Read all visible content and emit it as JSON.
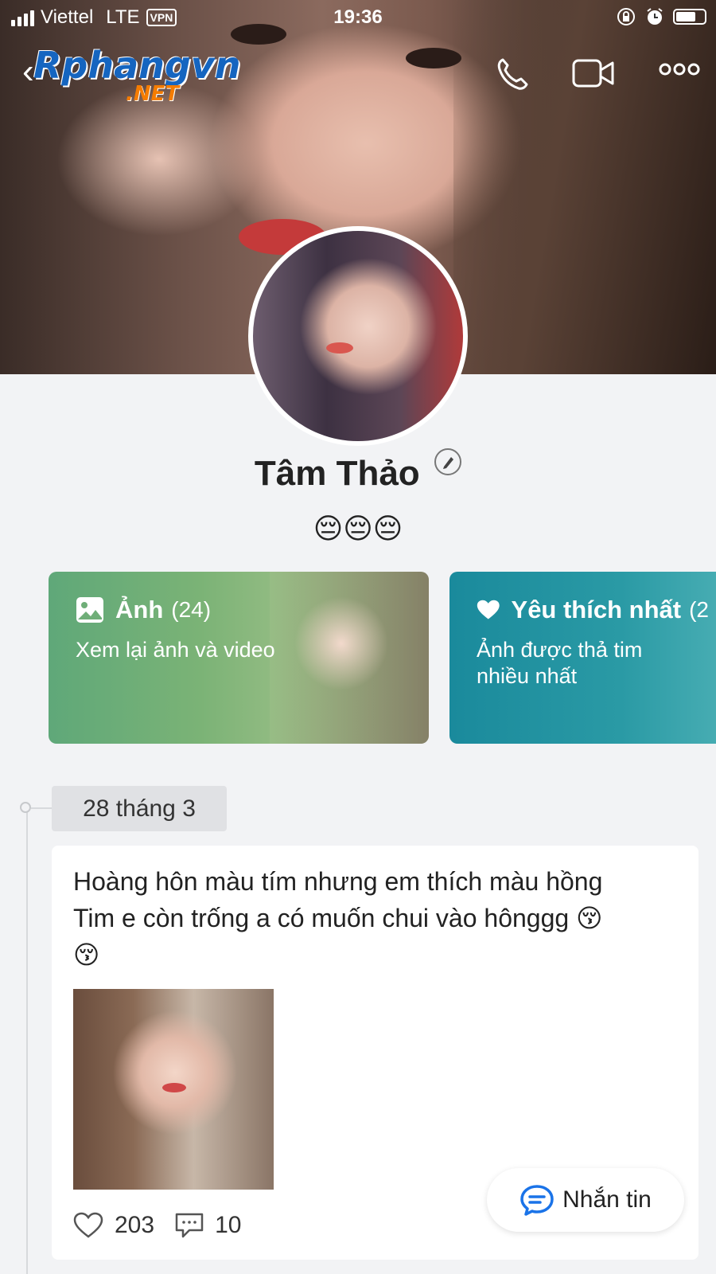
{
  "status_bar": {
    "carrier": "Viettel",
    "network": "LTE",
    "vpn": "VPN",
    "time": "19:36"
  },
  "watermark": {
    "main": "Rphangvn",
    "sub": ".NET"
  },
  "profile": {
    "name": "Tâm Thảo",
    "status": "😔😔😔"
  },
  "cards": {
    "photos": {
      "title": "Ảnh",
      "count": "(24)",
      "subtitle": "Xem lại ảnh và video"
    },
    "favorites": {
      "title": "Yêu thích nhất",
      "count": "(2",
      "subtitle": "Ảnh được thả tim nhiều nhất"
    }
  },
  "timeline": {
    "date": "28 tháng 3"
  },
  "post": {
    "text_line1": "Hoàng hôn màu tím nhưng em thích màu hồng",
    "text_line2": "Tim e còn trống a có muốn chui vào hônggg 😚",
    "text_line3": "😚",
    "likes": "203",
    "comments": "10"
  },
  "message_button": {
    "label": "Nhắn tin"
  },
  "colors": {
    "photos_card": "#6fae78",
    "favorites_card": "#1f90a0",
    "message_icon": "#1a73e8"
  },
  "icons": [
    "back-icon",
    "phone-icon",
    "video-call-icon",
    "more-icon",
    "edit-icon",
    "image-icon",
    "heart-icon",
    "like-icon",
    "comment-icon",
    "chat-icon"
  ]
}
